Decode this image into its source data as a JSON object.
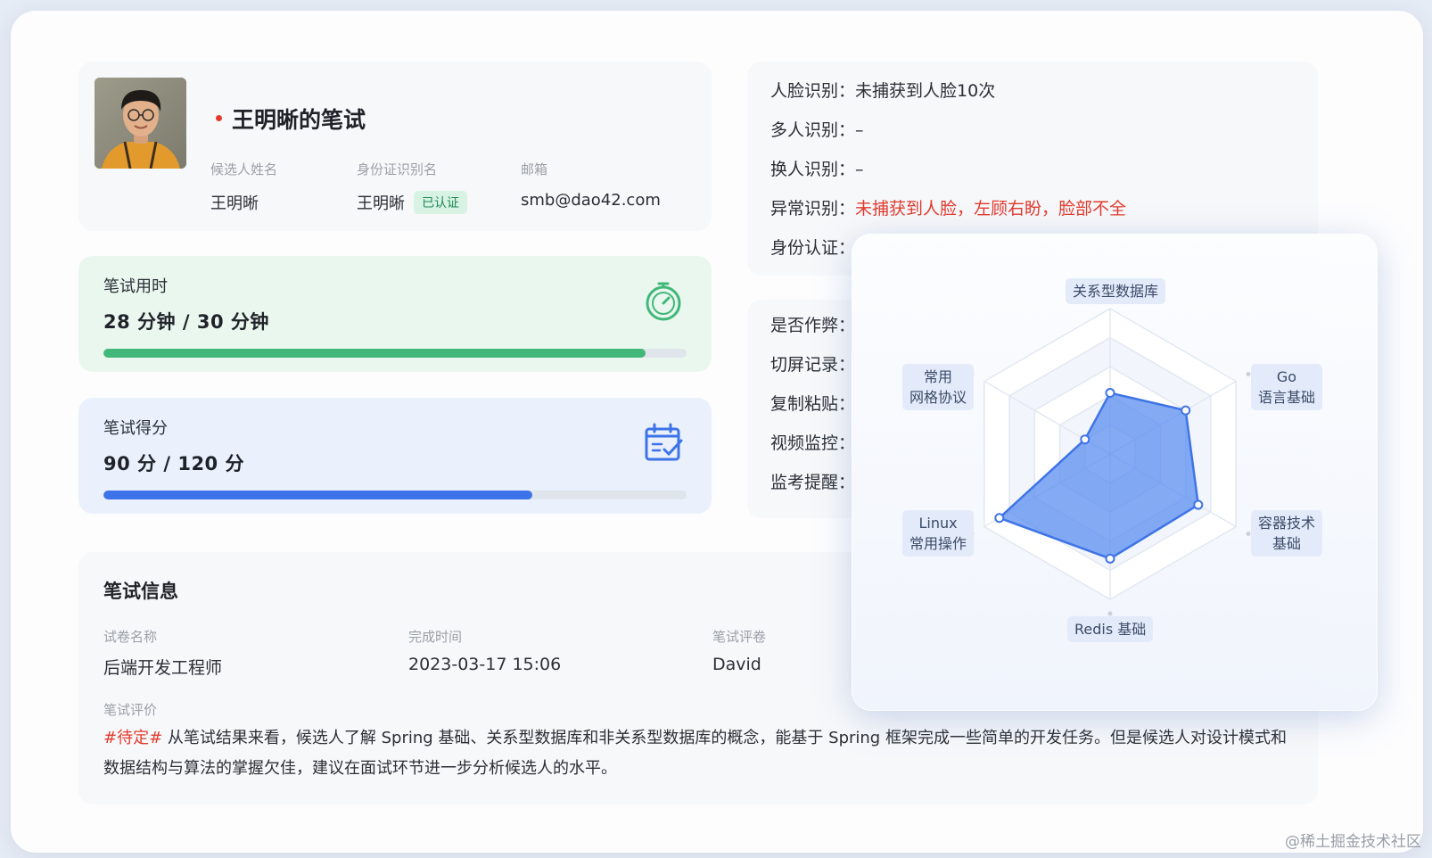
{
  "profile": {
    "title": "王明晰的笔试",
    "name_label": "候选人姓名",
    "name_value": "王明晰",
    "id_label": "身份证识别名",
    "id_value": "王明晰",
    "id_badge": "已认证",
    "email_label": "邮箱",
    "email_value": "smb@dao42.com"
  },
  "time_metric": {
    "label": "笔试用时",
    "value": "28 分钟 / 30 分钟",
    "progress": 0.93,
    "color": "#41b87a",
    "icon": "timer-icon"
  },
  "score_metric": {
    "label": "笔试得分",
    "value": "90 分 / 120 分",
    "progress": 0.735,
    "color": "#3d73e8",
    "icon": "calendar-check-icon"
  },
  "monitor_top": [
    {
      "label": "人脸识别：",
      "value": "未捕获到人脸10次",
      "alert": false
    },
    {
      "label": "多人识别：",
      "value": "–",
      "alert": false
    },
    {
      "label": "换人识别：",
      "value": "–",
      "alert": false
    },
    {
      "label": "异常识别：",
      "value": "未捕获到人脸，左顾右盼，脸部不全",
      "alert": true
    },
    {
      "label": "身份认证：",
      "value": "",
      "alert": false
    }
  ],
  "monitor_bottom": [
    {
      "label": "是否作弊："
    },
    {
      "label": "切屏记录："
    },
    {
      "label": "复制粘贴："
    },
    {
      "label": "视频监控："
    },
    {
      "label": "监考提醒："
    }
  ],
  "exam_info": {
    "title": "笔试信息",
    "paper_label": "试卷名称",
    "paper_value": "后端开发工程师",
    "finish_label": "完成时间",
    "finish_value": "2023-03-17 15:06",
    "grader_label": "笔试评卷",
    "grader_value": "David",
    "eval_label": "笔试评价",
    "eval_tag": "#待定#",
    "eval_text": " 从笔试结果来看，候选人了解 Spring 基础、关系型数据库和非关系型数据库的概念，能基于 Spring 框架完成一些简单的开发任务。但是候选人对设计模式和数据结构与算法的掌握欠佳，建议在面试环节进一步分析候选人的水平。"
  },
  "chart_data": {
    "type": "radar",
    "axes": [
      "关系型数据库",
      "Go 语言基础",
      "容器技术 基础",
      "Redis 基础",
      "Linux 常用操作",
      "常用 网络协议"
    ],
    "values": [
      0.42,
      0.6,
      0.7,
      0.72,
      0.88,
      0.2
    ],
    "range": [
      0,
      1
    ],
    "rings": 5,
    "fill_color": "#5b8ef0",
    "labels": {
      "top": "关系型数据库",
      "top_right_1": "Go",
      "top_right_2": "语言基础",
      "bottom_right_1": "容器技术",
      "bottom_right_2": "基础",
      "bottom": "Redis 基础",
      "bottom_left_1": "Linux",
      "bottom_left_2": "常用操作",
      "top_left_1": "常用",
      "top_left_2": "网格协议"
    }
  },
  "watermark": "@稀土掘金技术社区"
}
